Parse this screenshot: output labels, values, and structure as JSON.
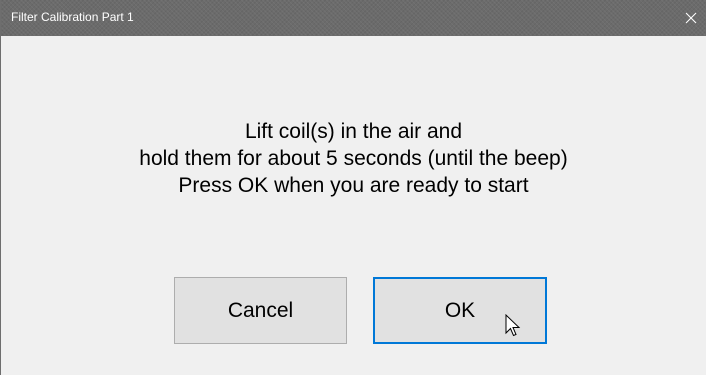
{
  "window": {
    "title": "Filter Calibration Part 1",
    "close_icon": "close-icon"
  },
  "message": {
    "line1": "Lift coil(s) in the air and",
    "line2": "hold them for about 5 seconds (until the beep)",
    "line3": "Press OK when you are ready to start"
  },
  "buttons": {
    "cancel_label": "Cancel",
    "ok_label": "OK"
  },
  "colors": {
    "titlebar": "#6b6b6b",
    "dialog_bg": "#f0f0f0",
    "button_bg": "#e1e1e1",
    "default_button_border": "#0078d7"
  },
  "cursor_icon": "arrow-cursor-icon"
}
